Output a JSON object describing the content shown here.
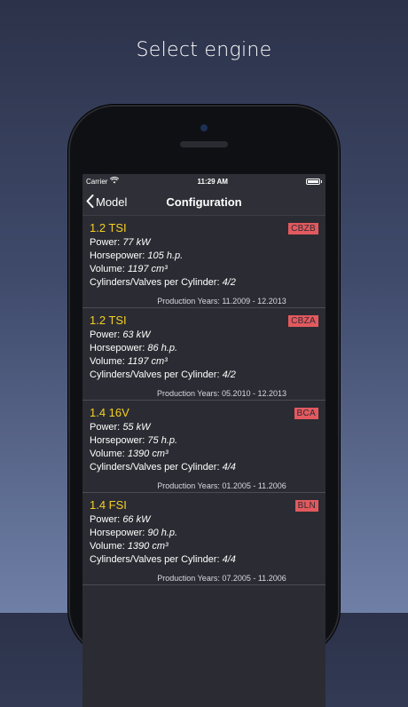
{
  "promo_title": "Select engine",
  "status_bar": {
    "carrier": "Carrier",
    "time": "11:29 AM"
  },
  "nav": {
    "back_label": "Model",
    "title": "Configuration"
  },
  "engines": [
    {
      "name": "1.2 TSI",
      "code": "CBZB",
      "power_label": "Power:",
      "power": "77 kW",
      "hp_label": "Horsepower:",
      "hp": "105 h.p.",
      "volume_label": "Volume:",
      "volume": "1197 cm³",
      "cyl_label": "Cylinders/Valves per Cylinder:",
      "cyl": "4/2",
      "production": "Production Years: 11.2009 - 12.2013"
    },
    {
      "name": "1.2 TSI",
      "code": "CBZA",
      "power_label": "Power:",
      "power": "63 kW",
      "hp_label": "Horsepower:",
      "hp": "86 h.p.",
      "volume_label": "Volume:",
      "volume": "1197 cm³",
      "cyl_label": "Cylinders/Valves per Cylinder:",
      "cyl": "4/2",
      "production": "Production Years: 05.2010 - 12.2013"
    },
    {
      "name": "1.4 16V",
      "code": "BCA",
      "power_label": "Power:",
      "power": "55 kW",
      "hp_label": "Horsepower:",
      "hp": "75 h.p.",
      "volume_label": "Volume:",
      "volume": "1390 cm³",
      "cyl_label": "Cylinders/Valves per Cylinder:",
      "cyl": "4/4",
      "production": "Production Years: 01.2005 - 11.2006"
    },
    {
      "name": "1.4 FSI",
      "code": "BLN",
      "power_label": "Power:",
      "power": "66 kW",
      "hp_label": "Horsepower:",
      "hp": "90 h.p.",
      "volume_label": "Volume:",
      "volume": "1390 cm³",
      "cyl_label": "Cylinders/Valves per Cylinder:",
      "cyl": "4/4",
      "production": "Production Years: 07.2005 - 11.2006"
    }
  ],
  "colors": {
    "accent_yellow": "#f6cf23",
    "code_badge": "#e3595e",
    "cell_bg": "#2b2c33"
  },
  "icons": {
    "wifi": "wifi-icon",
    "battery": "battery-icon",
    "back": "chevron-left-icon"
  }
}
